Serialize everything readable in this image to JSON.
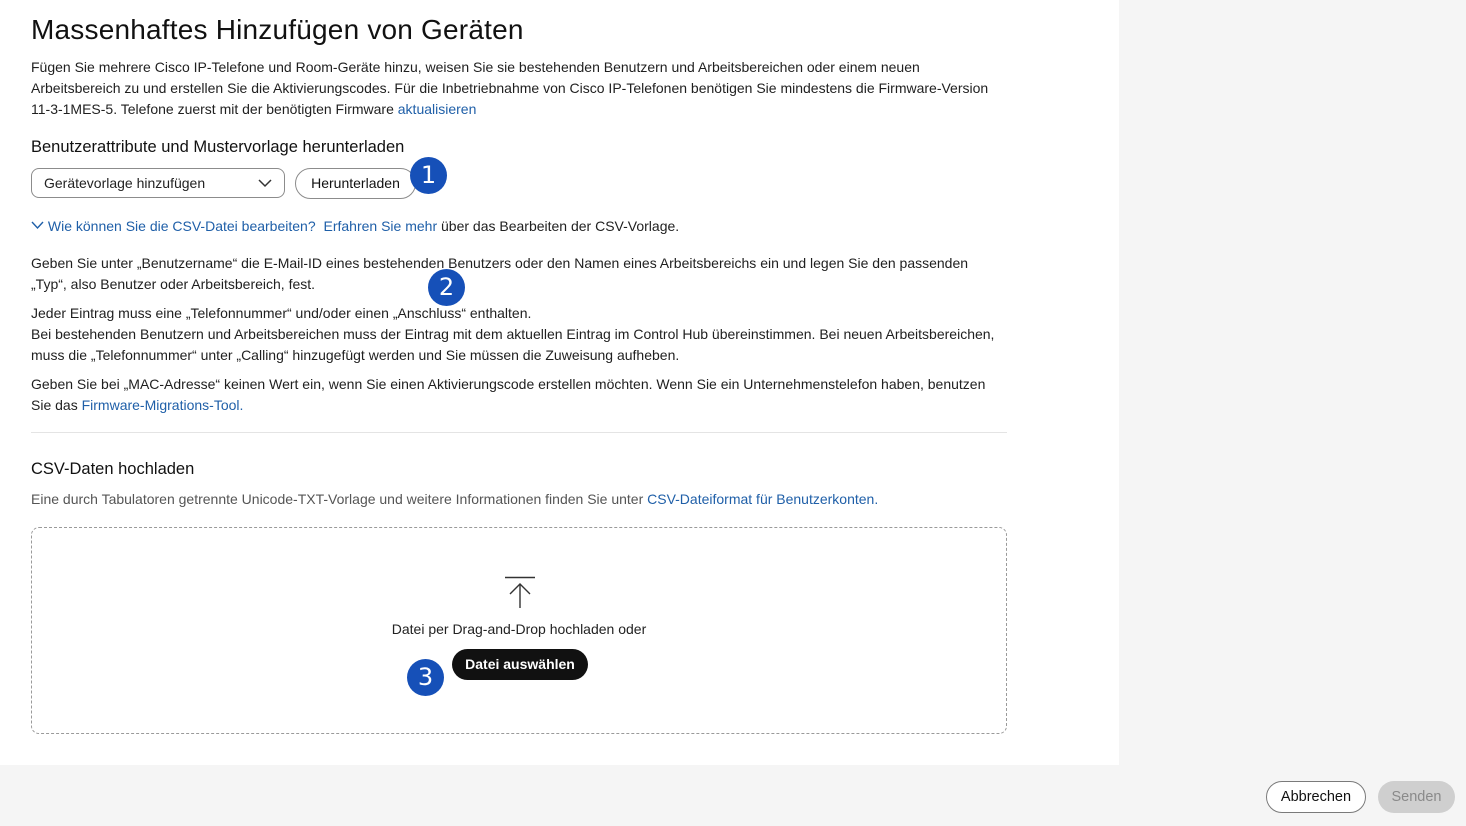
{
  "page": {
    "title": "Massenhaftes Hinzufügen von Geräten",
    "intro_text": "Fügen Sie mehrere Cisco IP-Telefone und Room-Geräte hinzu, weisen Sie sie bestehenden Benutzern und Arbeitsbereichen oder einem neuen Arbeitsbereich zu und erstellen Sie die Aktivierungscodes. Für die Inbetriebnahme von Cisco IP-Telefonen benötigen Sie mindestens die Firmware-Version 11-3-1MES-5. Telefone zuerst mit der benötigten Firmware",
    "intro_link": "aktualisieren"
  },
  "download": {
    "heading": "Benutzerattribute und Mustervorlage herunterladen",
    "select_value": "Gerätevorlage hinzufügen",
    "download_button": "Herunterladen",
    "csv_help_toggle": "Wie können Sie die CSV-Datei bearbeiten?",
    "learn_more_link": "Erfahren Sie mehr",
    "learn_more_suffix": "über das Bearbeiten der CSV-Vorlage."
  },
  "instructions": {
    "p1": "Geben Sie unter „Benutzername“ die E-Mail-ID eines bestehenden Benutzers oder den Namen eines Arbeitsbereichs ein und legen Sie den passenden „Typ“, also Benutzer oder Arbeitsbereich, fest.",
    "p2_line1": "Jeder Eintrag muss eine „Telefonnummer“ und/oder einen „Anschluss“ enthalten.",
    "p2_line2": "Bei bestehenden Benutzern und Arbeitsbereichen muss der Eintrag mit dem aktuellen Eintrag im Control Hub übereinstimmen. Bei neuen Arbeitsbereichen, muss die „Telefonnummer“ unter „Calling“ hinzugefügt werden und Sie müssen die Zuweisung aufheben.",
    "p3": "Geben Sie bei „MAC-Adresse“ keinen Wert ein, wenn Sie einen Aktivierungscode erstellen möchten. Wenn Sie ein Unternehmenstelefon haben, benutzen Sie das",
    "p3_link": "Firmware-Migrations-Tool."
  },
  "upload": {
    "heading": "CSV-Daten hochladen",
    "description": "Eine durch Tabulatoren getrennte Unicode-TXT-Vorlage und weitere Informationen finden Sie unter",
    "description_link": "CSV-Dateiformat für Benutzerkonten.",
    "drop_text": "Datei per Drag-and-Drop hochladen oder",
    "choose_button": "Datei auswählen"
  },
  "badges": {
    "one": "1",
    "two": "2",
    "three": "3"
  },
  "footer": {
    "cancel_button": "Abbrechen",
    "submit_button": "Senden"
  },
  "colors": {
    "link": "#1f5fa8",
    "badge": "#1650b8",
    "primary_button": "#111111",
    "disabled_button": "#cfcfcf"
  }
}
